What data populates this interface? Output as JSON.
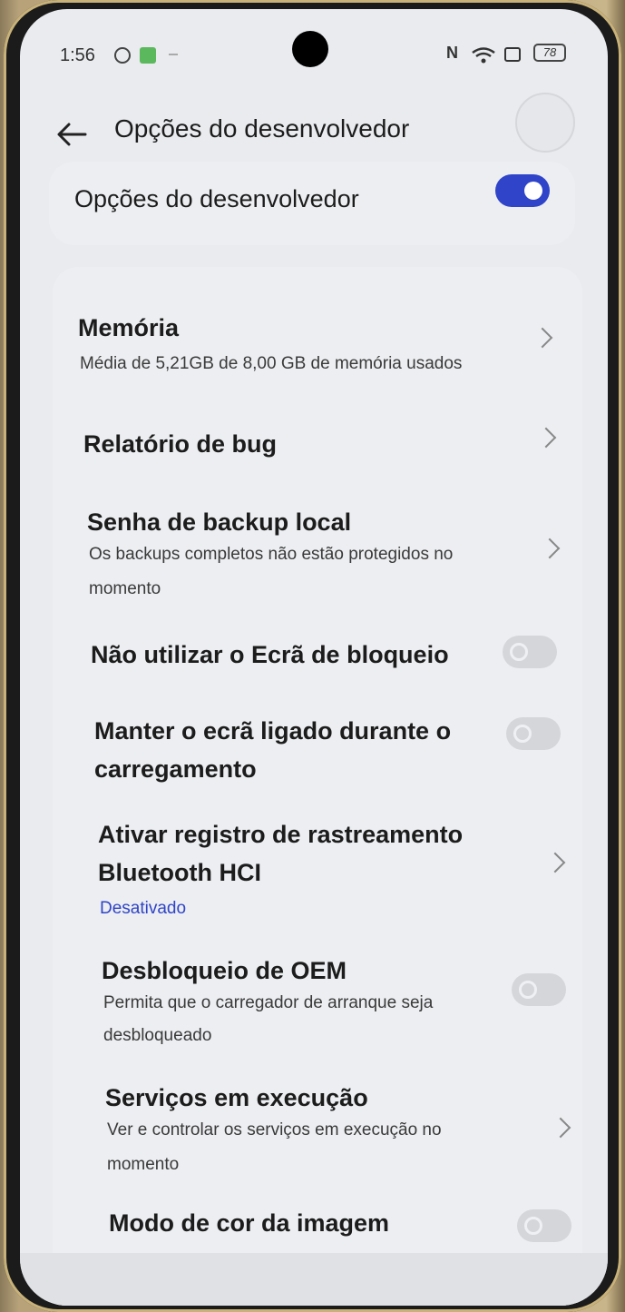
{
  "status_bar": {
    "time": "1:56",
    "battery": "78"
  },
  "header": {
    "title": "Opções do desenvolvedor"
  },
  "master": {
    "label": "Opções do desenvolvedor",
    "enabled": true
  },
  "rows": {
    "memory": {
      "title": "Memória",
      "subtitle": "Média de 5,21GB de 8,00 GB de memória usados"
    },
    "bug_report": {
      "title": "Relatório de bug"
    },
    "backup": {
      "title": "Senha de backup local",
      "subtitle_1": "Os backups completos não estão protegidos no",
      "subtitle_2": "momento"
    },
    "lockscreen": {
      "title": "Não utilizar o Ecrã de bloqueio",
      "enabled": false
    },
    "stay_awake": {
      "title_1": "Manter o ecrã ligado durante o",
      "title_2": "carregamento",
      "enabled": false
    },
    "bt_hci": {
      "title_1": "Ativar registro de rastreamento",
      "title_2": "Bluetooth HCI",
      "subtitle": "Desativado"
    },
    "oem": {
      "title": "Desbloqueio de OEM",
      "subtitle_1": "Permita que o carregador de arranque seja",
      "subtitle_2": "desbloqueado",
      "enabled": false
    },
    "services": {
      "title": "Serviços em execução",
      "subtitle_1": "Ver e controlar os serviços em execução no",
      "subtitle_2": "momento"
    },
    "color_mode": {
      "title": "Modo de cor da imagem",
      "enabled": false
    }
  },
  "colors": {
    "accent": "#2f44c8",
    "background": "#e9ebee"
  }
}
